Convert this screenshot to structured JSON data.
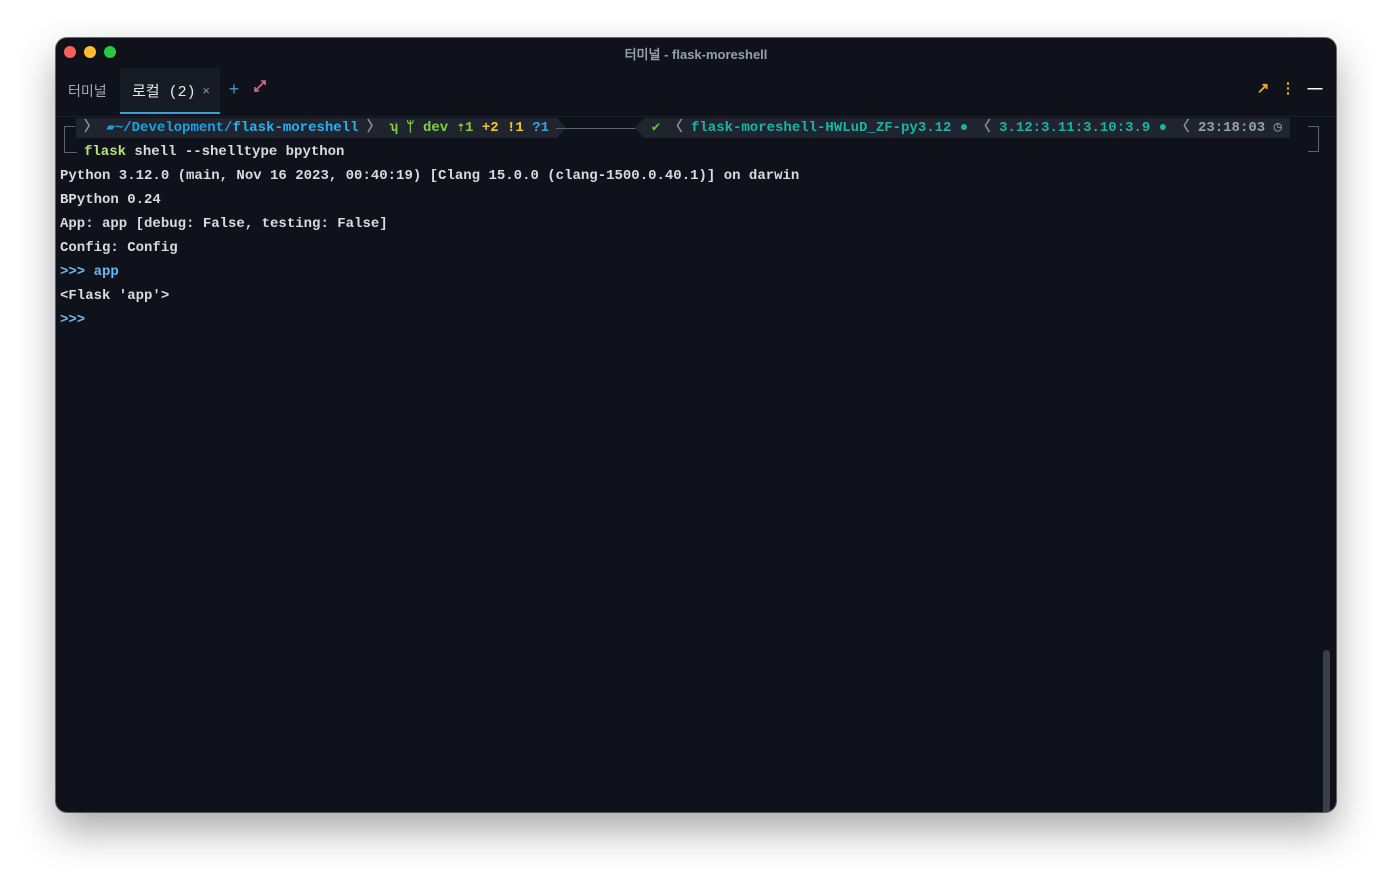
{
  "window": {
    "title": "터미널 - flask-moreshell"
  },
  "tabs": [
    {
      "label": "터미널"
    },
    {
      "label": "로컬 (2)",
      "close": "×"
    }
  ],
  "toolbar": {
    "plus": "+",
    "expand": "⤢",
    "arrow": "↗",
    "more": "⋮",
    "minimize": "—"
  },
  "prompt": {
    "os_icon": "",
    "folder_icon": "▰",
    "path_prefix": "~/Development/",
    "path_current": "flask-moreshell",
    "git_icon": "ʮ",
    "branch_icon": "ᛘ",
    "branch": "dev",
    "ahead": "⇡1",
    "staged": "+2",
    "unstaged": "!1",
    "untracked": "?1",
    "status_ok": "✔",
    "venv": "flask-moreshell-HWLuD_ZF-py3.12",
    "python_versions": "3.12:3.11:3.10:3.9",
    "time": "23:18:03",
    "clock_icon": "◷",
    "seg_sep": "〉",
    "seg_sep_r": "〈"
  },
  "command": {
    "program": "flask",
    "args": "shell --shelltype bpython"
  },
  "output": [
    "Python 3.12.0 (main, Nov 16 2023, 00:40:19) [Clang 15.0.0 (clang-1500.0.40.1)] on darwin",
    "BPython 0.24",
    "App: app [debug: False, testing: False]",
    "Config: Config"
  ],
  "repl": [
    {
      "prompt": ">>>",
      "input": " app"
    },
    {
      "result": "<Flask 'app'>"
    },
    {
      "prompt": ">>>",
      "input": ""
    }
  ]
}
